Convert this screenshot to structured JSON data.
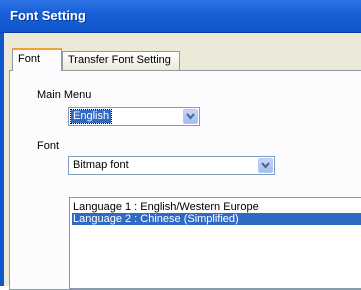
{
  "window": {
    "title": "Font Setting"
  },
  "tabs": [
    {
      "label": "Font",
      "active": true
    },
    {
      "label": "Transfer Font Setting",
      "active": false
    }
  ],
  "main_menu": {
    "label": "Main Menu",
    "selected": "English",
    "icon": "chevron-down-icon"
  },
  "font": {
    "label": "Font",
    "selected": "Bitmap font",
    "icon": "chevron-down-icon"
  },
  "languages": [
    {
      "label": "Language 1 : English/Western Europe",
      "selected": false
    },
    {
      "label": "Language 2 : Chinese (Simplified)",
      "selected": true
    }
  ],
  "colors": {
    "titlebar": "#0f55cc",
    "selection": "#316ac5",
    "tab_highlight": "#f1a33a",
    "dialog_bg": "#ece9d8"
  }
}
